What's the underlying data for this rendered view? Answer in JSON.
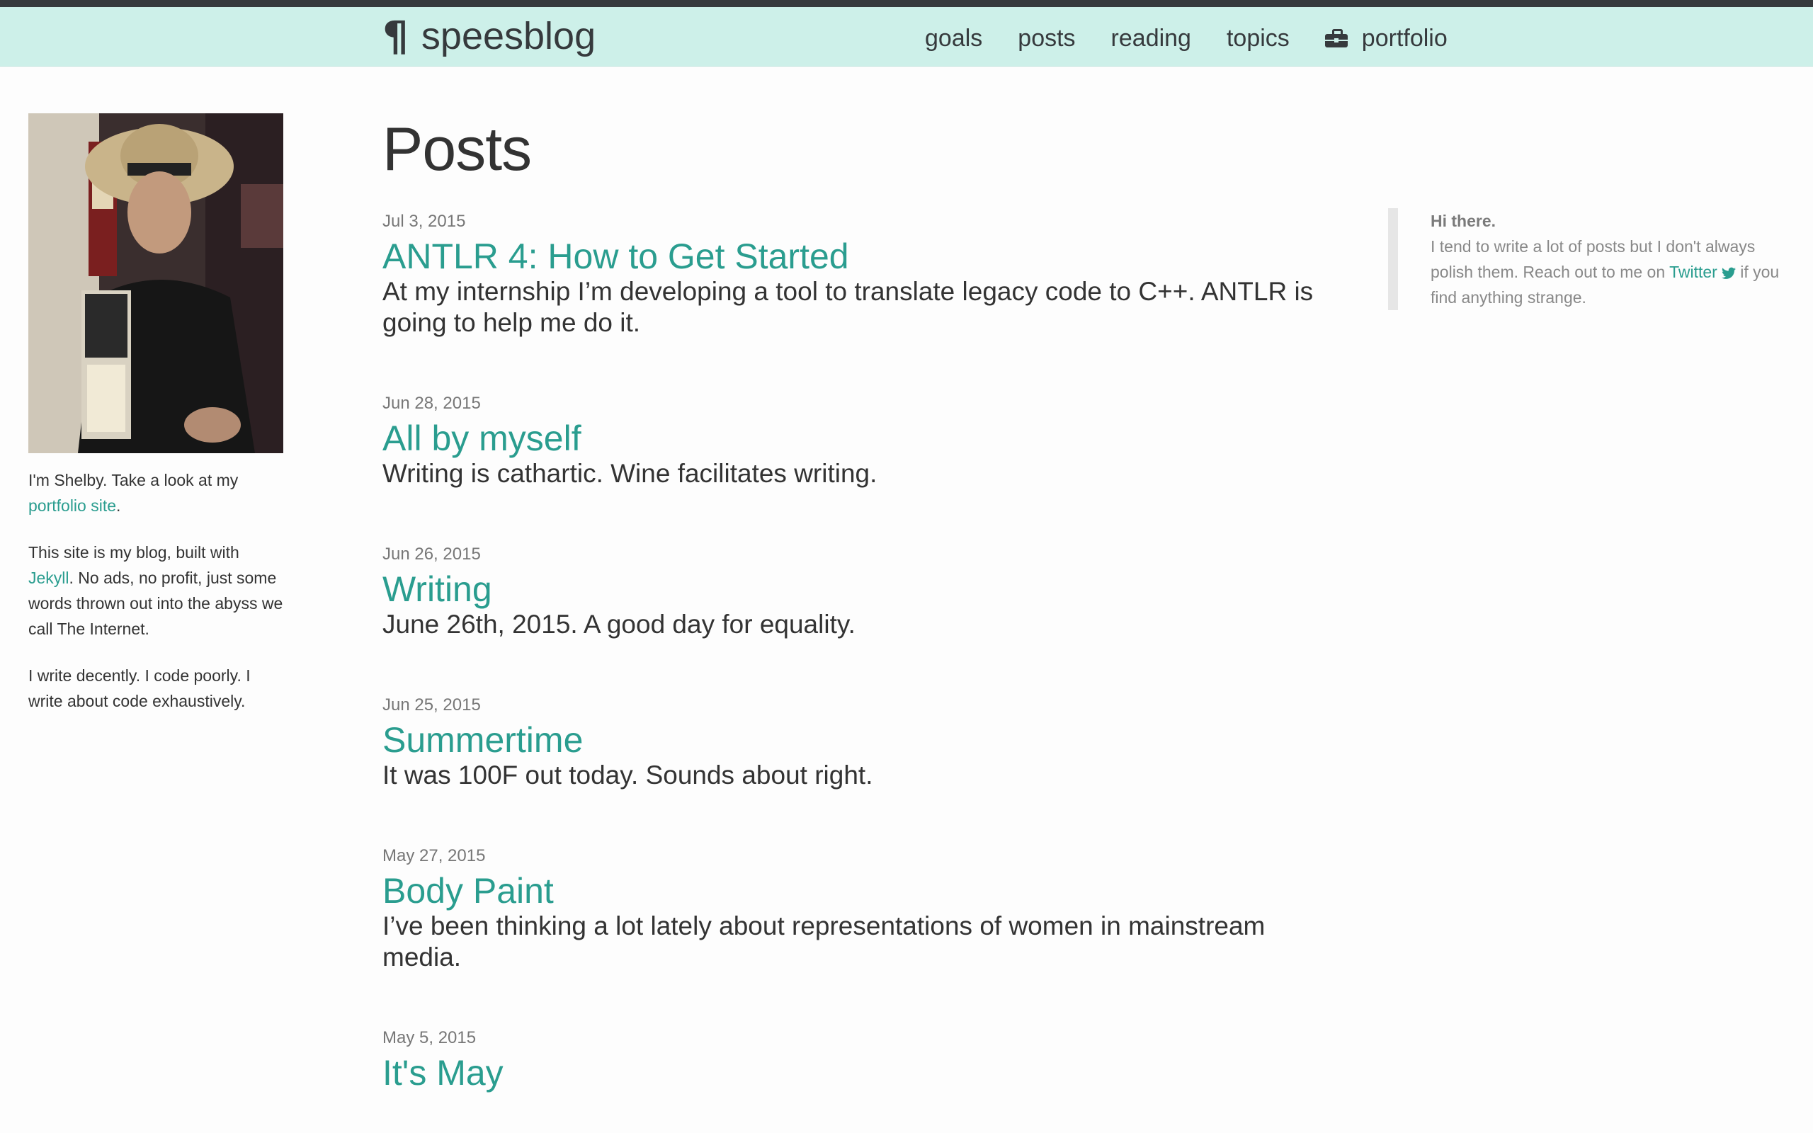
{
  "nav": {
    "brand": "speesblog",
    "brand_icon": "pilcrow-icon",
    "items": [
      {
        "label": "goals"
      },
      {
        "label": "posts"
      },
      {
        "label": "reading"
      },
      {
        "label": "topics"
      },
      {
        "label": "portfolio",
        "icon": "briefcase-icon"
      }
    ]
  },
  "bio": {
    "p1_before": "I'm Shelby. Take a look at my ",
    "p1_link": "portfolio site",
    "p1_after": ".",
    "p2_before": "This site is my blog, built with ",
    "p2_link": "Jekyll",
    "p2_after": ". No ads, no profit, just some words thrown out into the abyss we call The Internet.",
    "p3": "I write decently. I code poorly. I write about code exhaustively."
  },
  "main": {
    "title": "Posts",
    "posts": [
      {
        "date": "Jul 3, 2015",
        "title": "ANTLR 4: How to Get Started",
        "excerpt": "At my internship I’m developing a tool to translate legacy code to C++. ANTLR is going to help me do it."
      },
      {
        "date": "Jun 28, 2015",
        "title": "All by myself",
        "excerpt": "Writing is cathartic. Wine facilitates writing."
      },
      {
        "date": "Jun 26, 2015",
        "title": "Writing",
        "excerpt": "June 26th, 2015. A good day for equality."
      },
      {
        "date": "Jun 25, 2015",
        "title": "Summertime",
        "excerpt": "It was 100F out today. Sounds about right."
      },
      {
        "date": "May 27, 2015",
        "title": "Body Paint",
        "excerpt": "I’ve been thinking a lot lately about representations of women in mainstream media."
      },
      {
        "date": "May 5, 2015",
        "title": "It's May",
        "excerpt": ""
      }
    ]
  },
  "aside": {
    "heading": "Hi there.",
    "text_before": "I tend to write a lot of posts but I don't always polish them. Reach out to me on ",
    "link": "Twitter",
    "link_icon": "twitter-icon",
    "text_after": " if you find anything strange."
  },
  "colors": {
    "navbar_bg": "#cdf0e9",
    "link": "#2a9d8f",
    "text": "#333333",
    "topstrip": "#363a3d"
  }
}
